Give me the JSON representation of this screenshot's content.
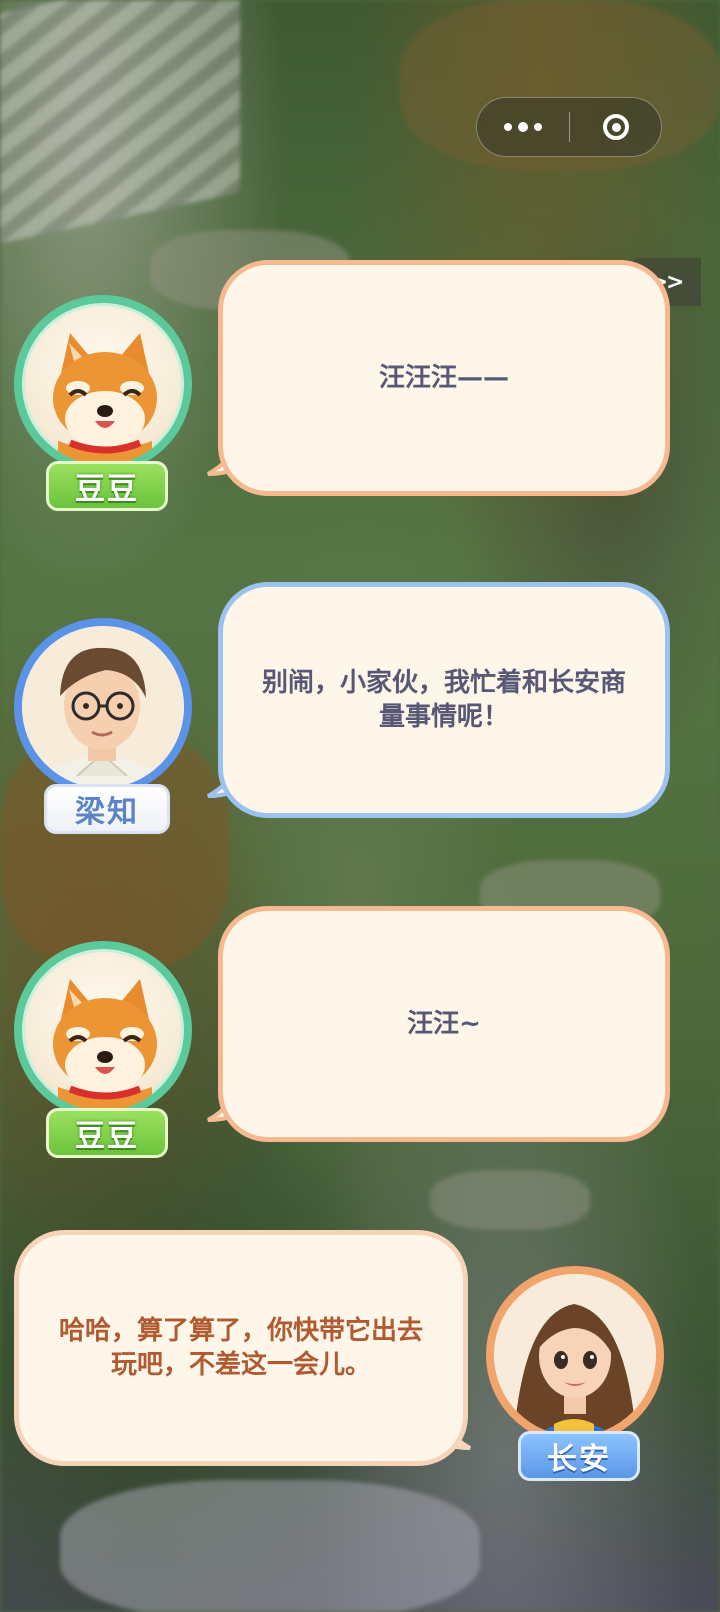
{
  "capsule": {
    "more_icon": "more-dots-icon",
    "close_icon": "target-circle-icon"
  },
  "skip": {
    "label": ">>"
  },
  "dialogues": [
    {
      "speaker": "豆豆",
      "text": "汪汪汪——",
      "avatar_icon": "shiba-dog-avatar"
    },
    {
      "speaker": "梁知",
      "text_line1": "别闹，小家伙，我忙着和长安商",
      "text_line2": "量事情呢！",
      "avatar_icon": "glasses-young-man-avatar"
    },
    {
      "speaker": "豆豆",
      "text": "汪汪~",
      "avatar_icon": "shiba-dog-avatar"
    },
    {
      "speaker": "长安",
      "text_line1": "哈哈，算了算了，你快带它出去",
      "text_line2": "玩吧，不差这一会儿。",
      "avatar_icon": "young-woman-avatar"
    }
  ],
  "colors": {
    "green_ring": "#5cc99b",
    "blue_ring": "#5b93e8",
    "orange_ring": "#f2a46b",
    "bubble_fill": "#fff6ea"
  }
}
